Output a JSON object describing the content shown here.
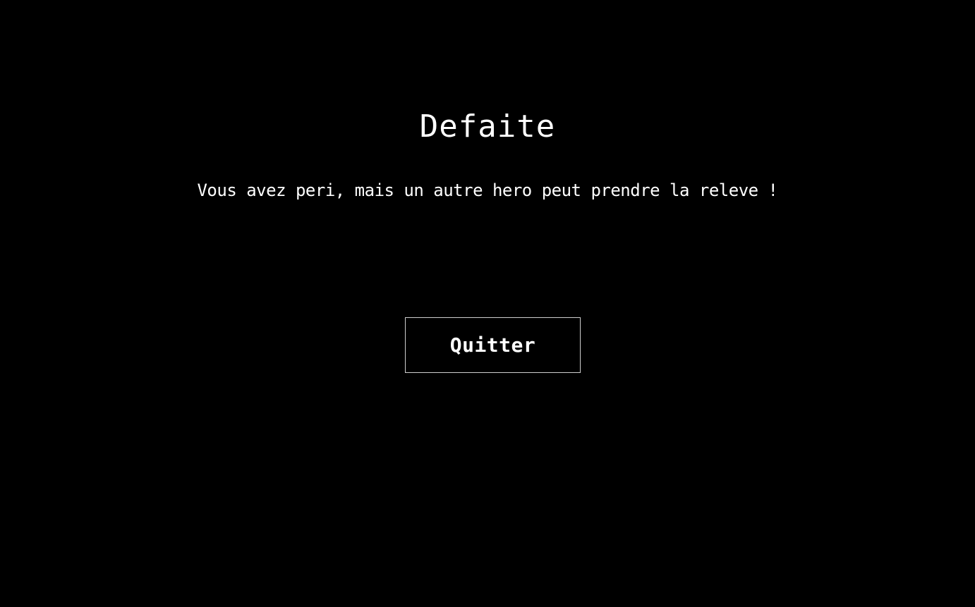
{
  "screen": {
    "title": "Defaite",
    "message": "Vous avez peri, mais un autre hero peut prendre la releve !",
    "quit_label": "Quitter"
  },
  "colors": {
    "background": "#000000",
    "text": "#ffffff",
    "button_border": "#cfcfcf"
  }
}
